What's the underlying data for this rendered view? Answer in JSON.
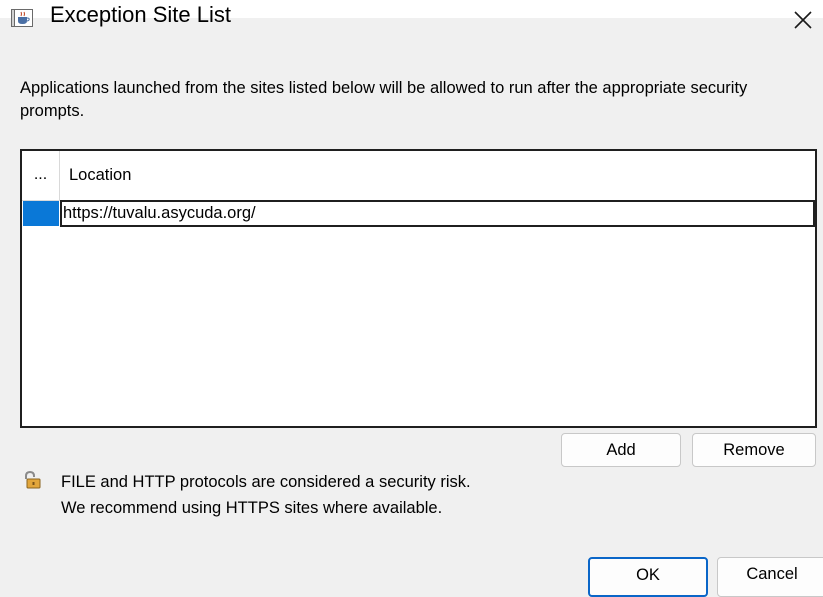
{
  "window": {
    "title": "Exception Site List",
    "close_symbol": "╳",
    "app_icon": "java-cup-icon"
  },
  "description": "Applications launched from the sites listed below will be allowed to run after the appropriate security prompts.",
  "site_list": {
    "columns": [
      "...",
      "Location"
    ],
    "rows": [
      {
        "location": "https://tuvalu.asycuda.org/"
      }
    ],
    "selected_row_color": "#0a78d7"
  },
  "list_buttons": {
    "add": "Add",
    "remove": "Remove"
  },
  "warning": {
    "icon": "padlock-icon",
    "line1": "FILE and HTTP protocols are considered a security risk.",
    "line2": "We recommend using HTTPS sites where available."
  },
  "footer_buttons": {
    "ok": "OK",
    "cancel": "Cancel"
  },
  "colors": {
    "accent": "#0a66c8",
    "dialog_background": "#f0f0f0"
  }
}
